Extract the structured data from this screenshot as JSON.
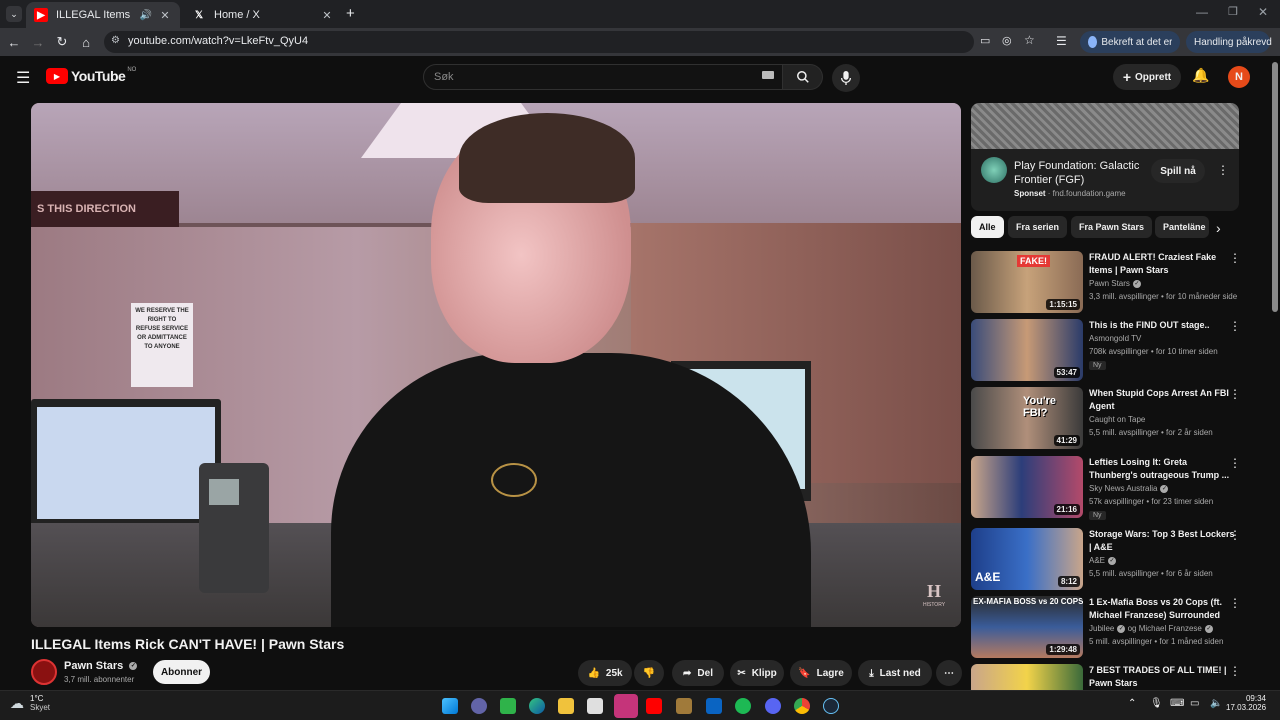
{
  "browser": {
    "tabs": [
      {
        "title": "ILLEGAL Items Rick CAN'T H",
        "active": true
      },
      {
        "title": "Home / X",
        "active": false
      }
    ],
    "url": "youtube.com/watch?v=LkeFtv_QyU4",
    "profile_pill": "Bekreft at det er deg",
    "action_pill": "Handling påkrevd"
  },
  "youtube": {
    "logo_text": "YouTube",
    "region": "NO",
    "search_placeholder": "Søk",
    "create_label": "Opprett",
    "avatar_letter": "N"
  },
  "video": {
    "title": "ILLEGAL Items Rick CAN'T HAVE! | Pawn Stars",
    "channel": "Pawn Stars",
    "subscribers": "3,7 mill. abonnenter",
    "subscribe_label": "Abonner",
    "likes": "25k",
    "share_label": "Del",
    "clip_label": "Klipp",
    "save_label": "Lagre",
    "download_label": "Last ned",
    "sign_text": "WE RESERVE THE RIGHT TO REFUSE SERVICE OR ADMITTANCE TO ANYONE",
    "banner_text": "S THIS DIRECTION",
    "watermark": "H",
    "watermark_sub": "HISTORY"
  },
  "ad": {
    "title": "Play Foundation: Galactic Frontier (FGF)",
    "sponsored": "Sponset",
    "domain": "fnd.foundation.game",
    "cta": "Spill nå"
  },
  "filter_chips": [
    "Alle",
    "Fra serien",
    "Fra Pawn Stars",
    "Panteläne"
  ],
  "recommendations": [
    {
      "title": "FRAUD ALERT! Craziest Fake Items | Pawn Stars",
      "channel": "Pawn Stars",
      "verified": true,
      "meta": "3,3 mill. avspillinger • for 10 måneder side",
      "duration": "1:15:15",
      "new": false,
      "thumb_text": "FAKE!"
    },
    {
      "title": "This is the FIND OUT stage..",
      "channel": "Asmongold TV",
      "verified": false,
      "meta": "708k avspillinger • for 10 timer siden",
      "duration": "53:47",
      "new": true,
      "thumb_text": ""
    },
    {
      "title": "When Stupid Cops Arrest An FBI Agent",
      "channel": "Caught on Tape",
      "verified": false,
      "meta": "5,5 mill. avspillinger • for 2 år siden",
      "duration": "41:29",
      "new": false,
      "thumb_text": "You're FBI?"
    },
    {
      "title": "Lefties Losing It: Greta Thunberg's outrageous Trump ...",
      "channel": "Sky News Australia",
      "verified": true,
      "meta": "57k avspillinger • for 23 timer siden",
      "duration": "21:16",
      "new": true,
      "thumb_text": ""
    },
    {
      "title": "Storage Wars: Top 3 Best Lockers | A&E",
      "channel": "A&E",
      "verified": true,
      "meta": "5,5 mill. avspillinger • for 6 år siden",
      "duration": "8:12",
      "new": false,
      "thumb_text": "A&E"
    },
    {
      "title": "1 Ex-Mafia Boss vs 20 Cops (ft. Michael Franzese) Surrounded",
      "channel": "Jubilee",
      "verified": true,
      "channel2": "og Michael Franzese",
      "meta": "5 mill. avspillinger • for 1 måned siden",
      "duration": "1:29:48",
      "new": false,
      "thumb_text": "EX-MAFIA BOSS vs 20 COPS"
    },
    {
      "title": "7 BEST TRADES OF ALL TIME! | Pawn Stars",
      "channel": "",
      "verified": false,
      "meta": "",
      "duration": "",
      "new": false,
      "thumb_text": ""
    }
  ],
  "new_badge": "Ny",
  "taskbar": {
    "weather_temp": "1°C",
    "weather_desc": "Skyet",
    "time": "09:34",
    "date": "17.03.2026"
  }
}
